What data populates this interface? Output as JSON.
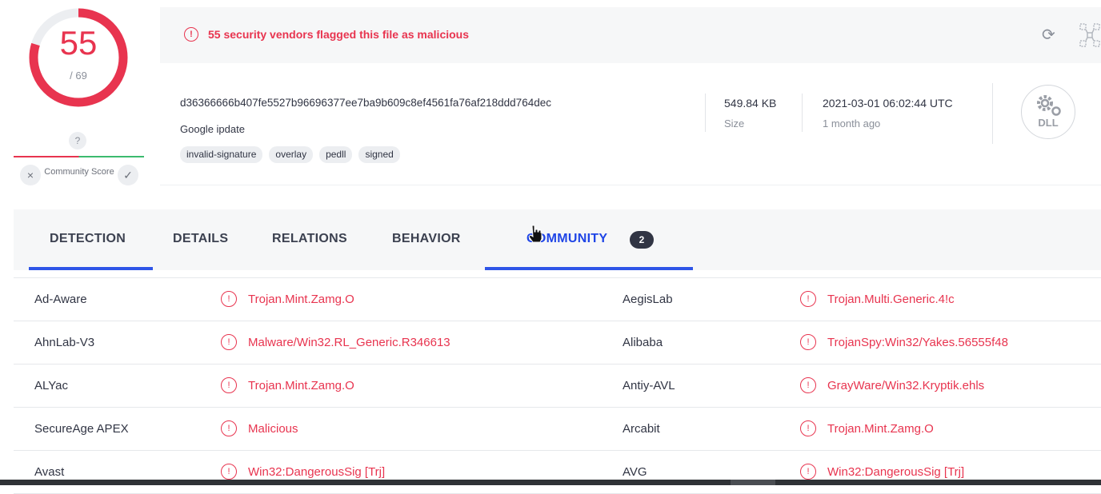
{
  "score": {
    "detections": "55",
    "total": "/ 69",
    "fraction": 0.797,
    "color": "#e8344f",
    "community_unknown_icon": "?",
    "community_label": "Community Score",
    "dislike_icon": "×",
    "like_icon": "✓"
  },
  "alert": {
    "icon": "!",
    "text": "55 security vendors flagged this file as malicious",
    "reload_icon": "⟳"
  },
  "file": {
    "hash": "d36366666b407fe5527b96696377ee7ba9b609c8ef4561fa76af218ddd764dec",
    "name": "Google ipdate",
    "tags": [
      "invalid-signature",
      "overlay",
      "pedll",
      "signed"
    ],
    "size_value": "549.84 KB",
    "size_label": "Size",
    "date_value": "2021-03-01 06:02:44 UTC",
    "date_relative": "1 month ago",
    "type_badge": "DLL"
  },
  "tabs": {
    "detection": "DETECTION",
    "details": "DETAILS",
    "relations": "RELATIONS",
    "behavior": "BEHAVIOR",
    "community": "COMMUNITY",
    "community_count": "2"
  },
  "detections": [
    {
      "vendor_left": "Ad-Aware",
      "result_left": "Trojan.Mint.Zamg.O",
      "vendor_right": "AegisLab",
      "result_right": "Trojan.Multi.Generic.4!c"
    },
    {
      "vendor_left": "AhnLab-V3",
      "result_left": "Malware/Win32.RL_Generic.R346613",
      "vendor_right": "Alibaba",
      "result_right": "TrojanSpy:Win32/Yakes.56555f48"
    },
    {
      "vendor_left": "ALYac",
      "result_left": "Trojan.Mint.Zamg.O",
      "vendor_right": "Antiy-AVL",
      "result_right": "GrayWare/Win32.Kryptik.ehls"
    },
    {
      "vendor_left": "SecureAge APEX",
      "result_left": "Malicious",
      "vendor_right": "Arcabit",
      "result_right": "Trojan.Mint.Zamg.O"
    },
    {
      "vendor_left": "Avast",
      "result_left": "Win32:DangerousSig [Trj]",
      "vendor_right": "AVG",
      "result_right": "Win32:DangerousSig [Trj]"
    }
  ]
}
